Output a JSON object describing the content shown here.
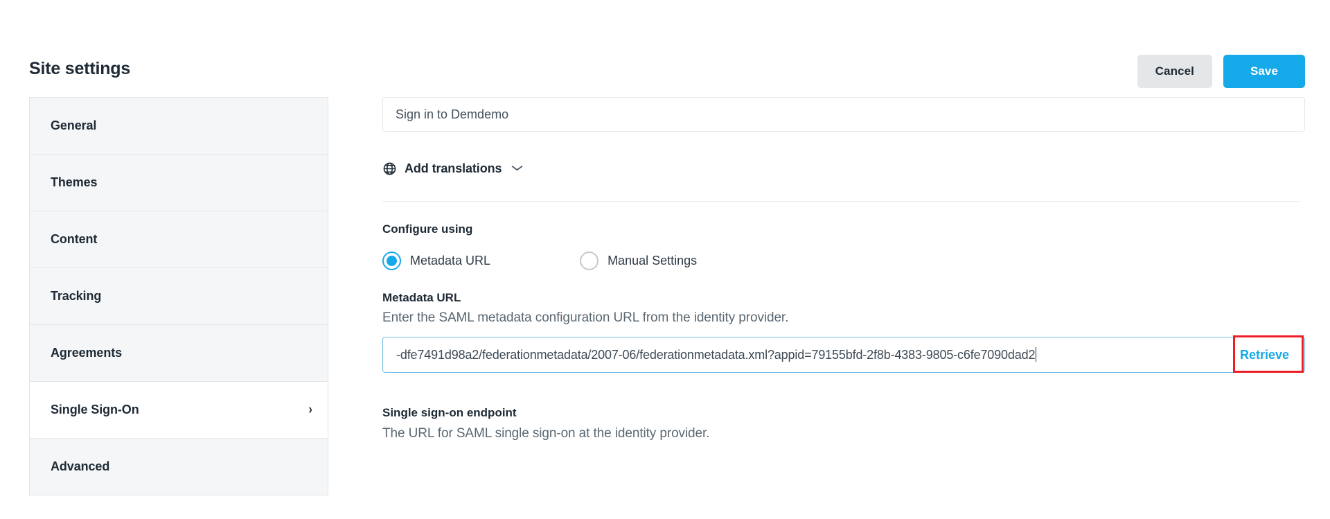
{
  "header": {
    "title": "Site settings",
    "cancel_label": "Cancel",
    "save_label": "Save"
  },
  "sidebar": {
    "items": [
      {
        "label": "General",
        "active": false,
        "chevron": ""
      },
      {
        "label": "Themes",
        "active": false,
        "chevron": ""
      },
      {
        "label": "Content",
        "active": false,
        "chevron": ""
      },
      {
        "label": "Tracking",
        "active": false,
        "chevron": ""
      },
      {
        "label": "Agreements",
        "active": false,
        "chevron": ""
      },
      {
        "label": "Single Sign-On",
        "active": true,
        "chevron": "›"
      },
      {
        "label": "Advanced",
        "active": false,
        "chevron": ""
      }
    ]
  },
  "main": {
    "signin_title_value": "Sign in to Demdemo",
    "signin_title_placeholder": "Sign in to Demdemo",
    "translations_label": "Add translations",
    "translations_chevron": "⌵",
    "globe_icon": "globe-icon",
    "configure_using_label": "Configure using",
    "radio_options": [
      {
        "label": "Metadata URL",
        "selected": true
      },
      {
        "label": "Manual Settings",
        "selected": false
      }
    ],
    "metadata_url": {
      "title": "Metadata URL",
      "description": "Enter the SAML metadata configuration URL from the identity provider.",
      "value": "-dfe7491d98a2/federationmetadata/2007-06/federationmetadata.xml?appid=79155bfd-2f8b-4383-9805-c6fe7090dad2",
      "retrieve_label": "Retrieve"
    },
    "sso_endpoint": {
      "title": "Single sign-on endpoint",
      "description": "The URL for SAML single sign-on at the identity provider."
    }
  },
  "colors": {
    "accent_blue": "#16a9e9",
    "highlight_red": "#ee1c25",
    "text_dark": "#1e2a35",
    "text_muted": "#5a6872",
    "sidebar_bg": "#f4f6f7"
  }
}
